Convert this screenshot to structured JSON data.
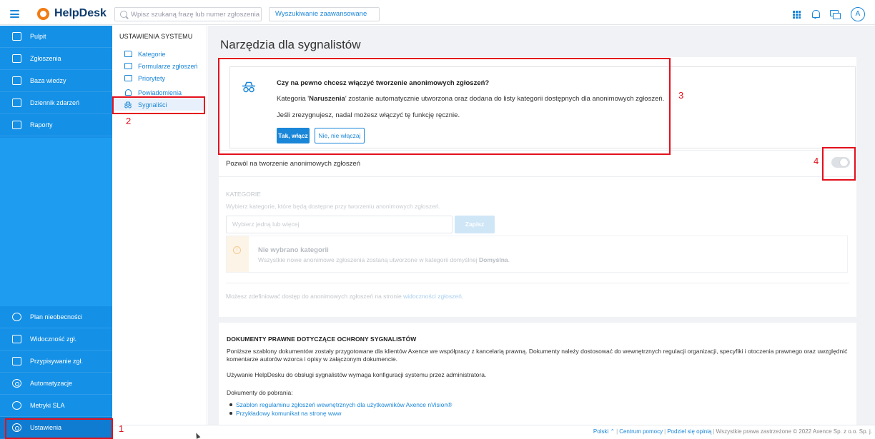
{
  "app": {
    "name": "HelpDesk"
  },
  "search": {
    "placeholder": "Wpisz szukaną frazę lub numer zgłoszenia",
    "advanced": "Wyszukiwanie zaawansowane"
  },
  "user": {
    "avatar": "A"
  },
  "sidebar": {
    "items": [
      {
        "label": "Pulpit"
      },
      {
        "label": "Zgłoszenia"
      },
      {
        "label": "Baza wiedzy"
      },
      {
        "label": "Dziennik zdarzeń"
      },
      {
        "label": "Raporty"
      },
      {
        "label": "Plan nieobecności"
      },
      {
        "label": "Widoczność zgł."
      },
      {
        "label": "Przypisywanie zgł."
      },
      {
        "label": "Automatyzacje"
      },
      {
        "label": "Metryki SLA"
      },
      {
        "label": "Ustawienia"
      }
    ]
  },
  "submenu": {
    "title": "USTAWIENIA SYSTEMU",
    "items": [
      {
        "label": "Kategorie"
      },
      {
        "label": "Formularze zgłoszeń"
      },
      {
        "label": "Priorytety"
      },
      {
        "label": "Powiadomienia"
      },
      {
        "label": "Sygnaliści"
      }
    ]
  },
  "main": {
    "title": "Narzędzia dla sygnalistów",
    "confirm": {
      "title": "Czy na pewno chcesz włączyć tworzenie anonimowych zgłoszeń?",
      "text_before": "Kategoria '",
      "category": "Naruszenia",
      "text_after": "' zostanie automatycznie utworzona oraz dodana do listy kategorii dostępnych dla anonimowych zgłoszeń.",
      "note": "Jeśli zrezygnujesz, nadal możesz włączyć tę funkcję ręcznie.",
      "yes": "Tak, włącz",
      "no": "Nie, nie włączaj"
    },
    "allow_label": "Pozwól na tworzenie anonimowych zgłoszeń",
    "allow_enabled": false,
    "categories": {
      "heading": "KATEGORIE",
      "description": "Wybierz kategorie, które będą dostępne przy tworzeniu anonimowych zgłoszeń.",
      "select_placeholder": "Wybierz jedną lub więcej",
      "save": "Zapisz",
      "alert_title": "Nie wybrano kategorii",
      "alert_text": "Wszystkie nowe anonimowe zgłoszenia zostaną utworzone w kategorii domyślnej ",
      "alert_default": "Domyślna",
      "alert_end": "."
    },
    "access": {
      "text": "Możesz zdefiniować dostęp do anonimowych zgłoszeń na stronie ",
      "link": "widoczności zgłoszeń",
      "end": "."
    },
    "docs": {
      "title": "DOKUMENTY PRAWNE DOTYCZĄCE OCHRONY SYGNALISTÓW",
      "p1": "Poniższe szablony dokumentów zostały przygotowane dla klientów Axence we współpracy z kancelarią prawną. Dokumenty należy dostosować do wewnętrznych regulacji organizacji, specyfiki i otoczenia prawnego oraz uwzględnić komentarze autorów wzorca i opisy w załączonym dokumencie.",
      "p2": "Używanie HelpDesku do obsługi sygnalistów wymaga konfiguracji systemu przez administratora.",
      "p3": "Dokumenty do pobrania:",
      "links": [
        "Szablon regulaminu zgłoszeń wewnętrznych dla użytkowników Axence nVision®",
        "Przykładowy komunikat na stronę www"
      ]
    }
  },
  "footer": {
    "language": "Polski ⌃",
    "help": "Centrum pomocy",
    "feedback": "Podziel się opinią",
    "copyright": "Wszystkie prawa zastrzeżone © 2022 Axence Sp. z o.o. Sp. j."
  },
  "annotations": [
    "1",
    "2",
    "3",
    "4"
  ],
  "colors": {
    "accent": "#1a86d8",
    "sidebar": "#1e9cf0",
    "annotation": "#e3101c",
    "brand_orange": "#f07c14"
  }
}
